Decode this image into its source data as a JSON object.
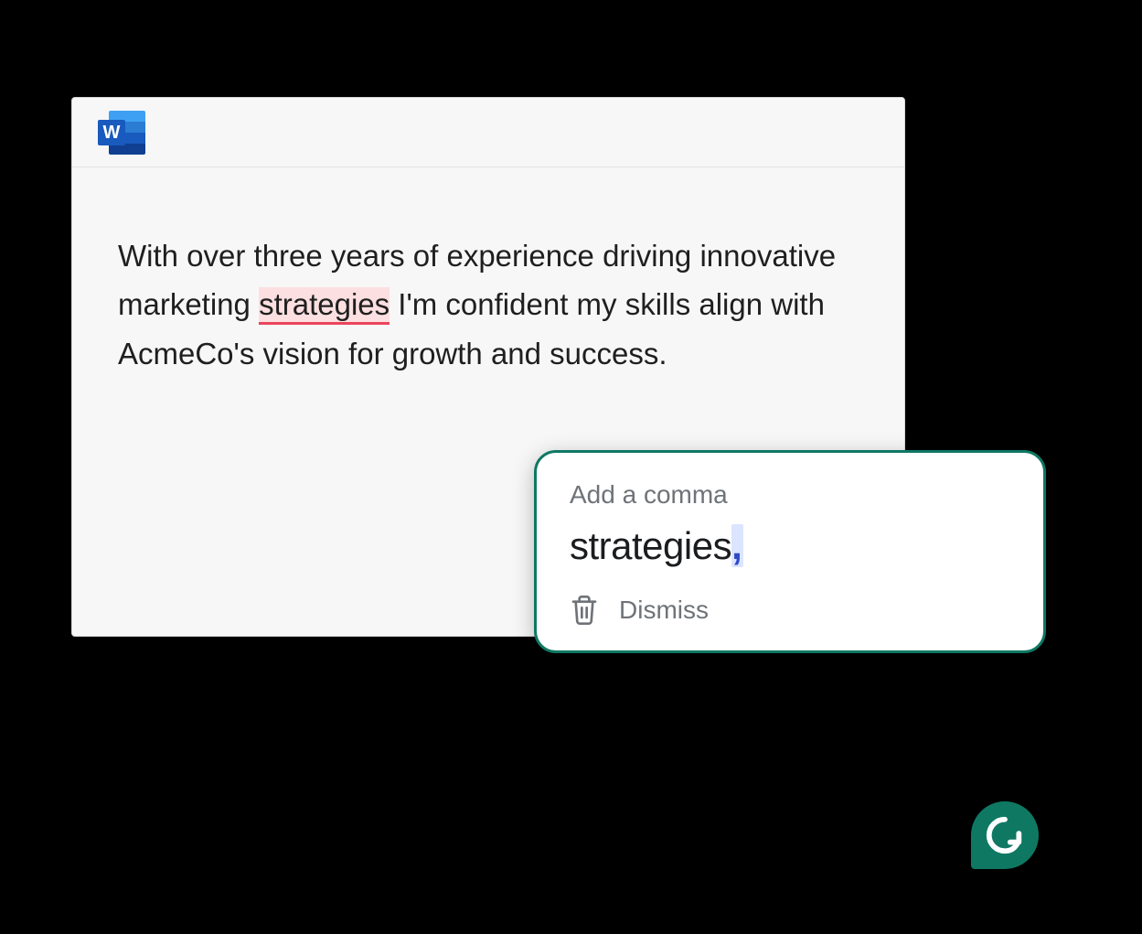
{
  "app": {
    "icon_label": "W"
  },
  "document": {
    "text_before": "With over three years of experience driving innovative marketing ",
    "flagged_word": "strategies",
    "text_after": " I'm confident my skills align with AcmeCo's vision for growth and success."
  },
  "suggestion": {
    "title": "Add a comma",
    "corrected_word": "strategies",
    "inserted_punctuation": ",",
    "dismiss_label": "Dismiss"
  },
  "colors": {
    "brand_green": "#0f7863",
    "error_underline": "#e9455b",
    "error_bg": "#fcdfe0",
    "insert_blue": "#2f4ac6"
  }
}
